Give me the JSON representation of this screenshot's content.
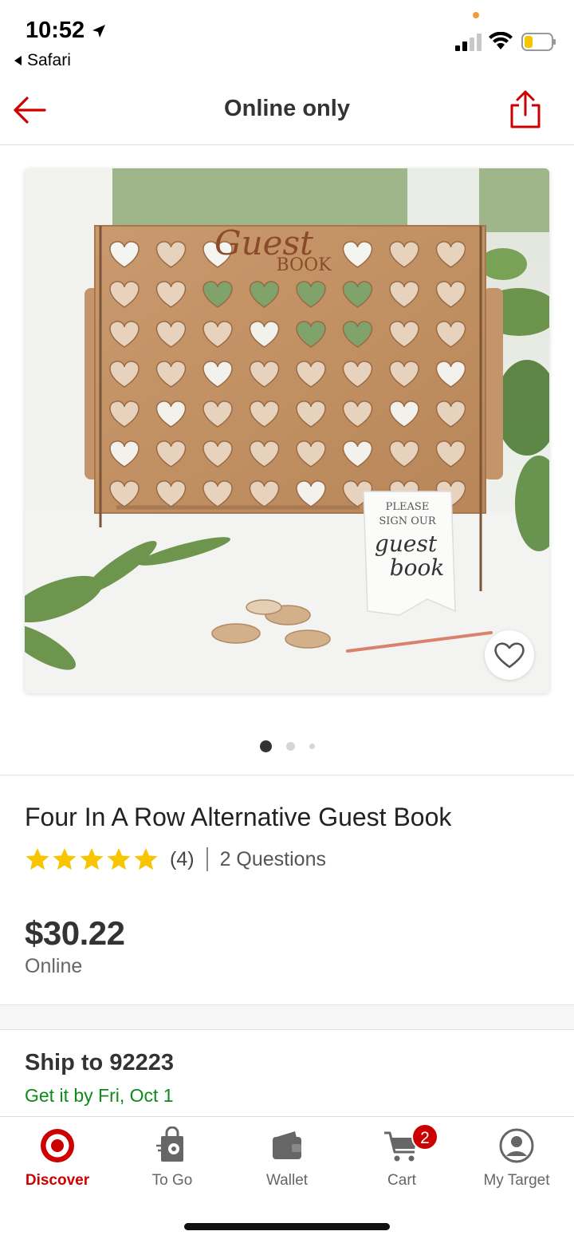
{
  "status_bar": {
    "time": "10:52",
    "back_app": "Safari"
  },
  "header": {
    "title": "Online only",
    "back_icon": "arrow-left-icon",
    "share_icon": "share-icon"
  },
  "image": {
    "description_alt": "Four In A Row Alternative Guest Book",
    "board_title_line1": "Guest",
    "board_title_line2": "BOOK",
    "sign_line1": "PLEASE",
    "sign_line2": "SIGN OUR",
    "sign_line3": "guest",
    "sign_line4": "book",
    "carousel_count": 3,
    "carousel_active": 1
  },
  "product": {
    "title": "Four In A Row Alternative Guest Book",
    "rating": 5,
    "review_count": "(4)",
    "questions": "2 Questions",
    "price": "$30.22",
    "price_note": "Online"
  },
  "shipping": {
    "title": "Ship to 92223",
    "date": "Get it by Fri, Oct 1"
  },
  "tabbar": {
    "items": [
      {
        "label": "Discover",
        "icon": "target-logo-icon",
        "active": true
      },
      {
        "label": "To Go",
        "icon": "shopping-bag-icon",
        "active": false
      },
      {
        "label": "Wallet",
        "icon": "wallet-icon",
        "active": false
      },
      {
        "label": "Cart",
        "icon": "cart-icon",
        "active": false,
        "badge": "2"
      },
      {
        "label": "My Target",
        "icon": "account-icon",
        "active": false
      }
    ]
  },
  "colors": {
    "brand_red": "#cc0000",
    "ship_green": "#0c8a1a",
    "star_yellow": "#f7c600"
  }
}
